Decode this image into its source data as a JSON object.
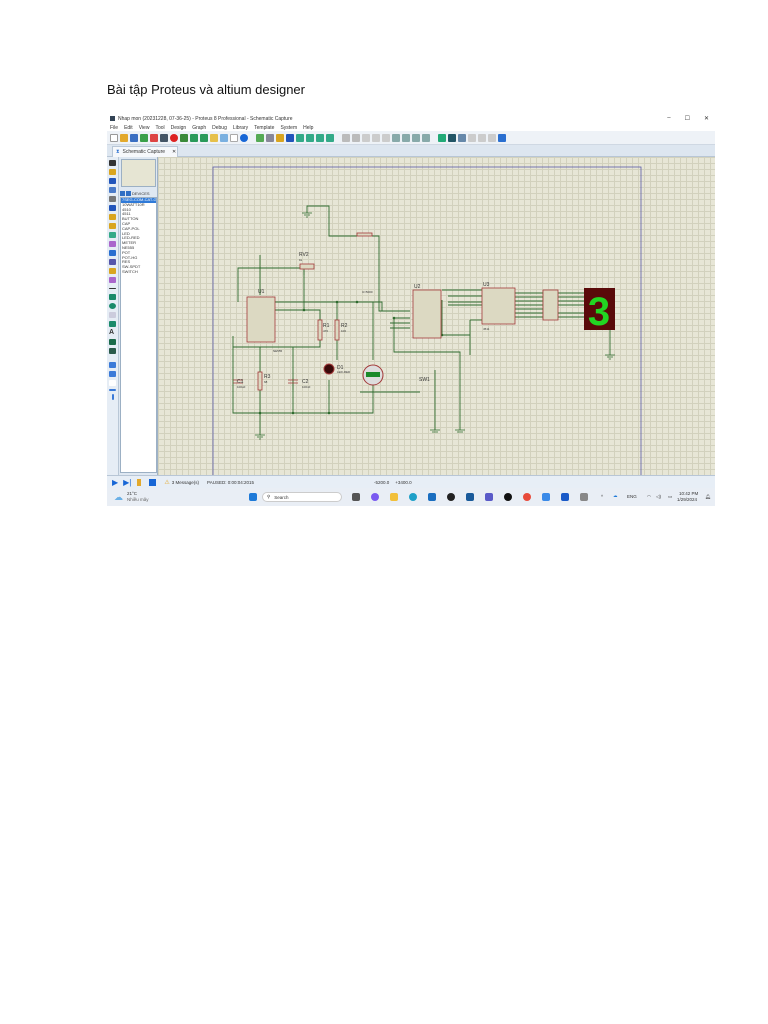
{
  "document": {
    "heading": "Bài tập Proteus và altium designer"
  },
  "window": {
    "title": "Nhap mon (20231228, 07-36-25) - Proteus 8 Professional - Schematic Capture",
    "controls": [
      "–",
      "☐",
      "✕"
    ]
  },
  "menu": [
    "File",
    "Edit",
    "View",
    "Tool",
    "Design",
    "Graph",
    "Debug",
    "Library",
    "Template",
    "System",
    "Help"
  ],
  "tab": {
    "label": "Schematic Capture",
    "close": "✕"
  },
  "device_panel": {
    "header": "DEVICES",
    "items": [
      "7SEG-COM-CAT-G",
      "10WATT10R",
      "4510",
      "4511",
      "BUTTON",
      "CAP",
      "CAP-POL",
      "LED",
      "LED-RED",
      "METER",
      "NE555",
      "POT",
      "POT-HG",
      "RES",
      "SW-SPDT",
      "SWITCH"
    ],
    "selected": 0
  },
  "schematic": {
    "labels": {
      "u1": "U1",
      "u1_part": "NE555",
      "rv2": "RV2",
      "rv2_val": "1k",
      "r1": "R1",
      "r1_val": "470",
      "r2": "R2",
      "r2_val": "100",
      "d1": "D1",
      "d1_part": "LED-RED",
      "c1": "C1",
      "c1_val": "100uF",
      "r3": "R3",
      "r3_val": "68",
      "c2": "C2",
      "c2_val": "100nF",
      "u2": "U2",
      "u3": "U3",
      "u3_part": "4511",
      "sw1": "SW1",
      "probe": "U=5000"
    },
    "display_digit": "3",
    "colors": {
      "wire": "#2e6b2e",
      "part": "#a33a3a",
      "segment": "#22d622",
      "display_bg": "#5a0a0a"
    }
  },
  "status": {
    "messages": "3 Message(s)",
    "sim_state": "PAUSED: 0:00:04:2015",
    "coord_x": "-5200.0",
    "coord_y": "+3400.0"
  },
  "taskbar": {
    "weather_temp": "21°C",
    "weather_desc": "Nhiều mây",
    "search": "Search",
    "lang": "ENG",
    "time": "10:42 PM",
    "date": "1/29/2024"
  }
}
